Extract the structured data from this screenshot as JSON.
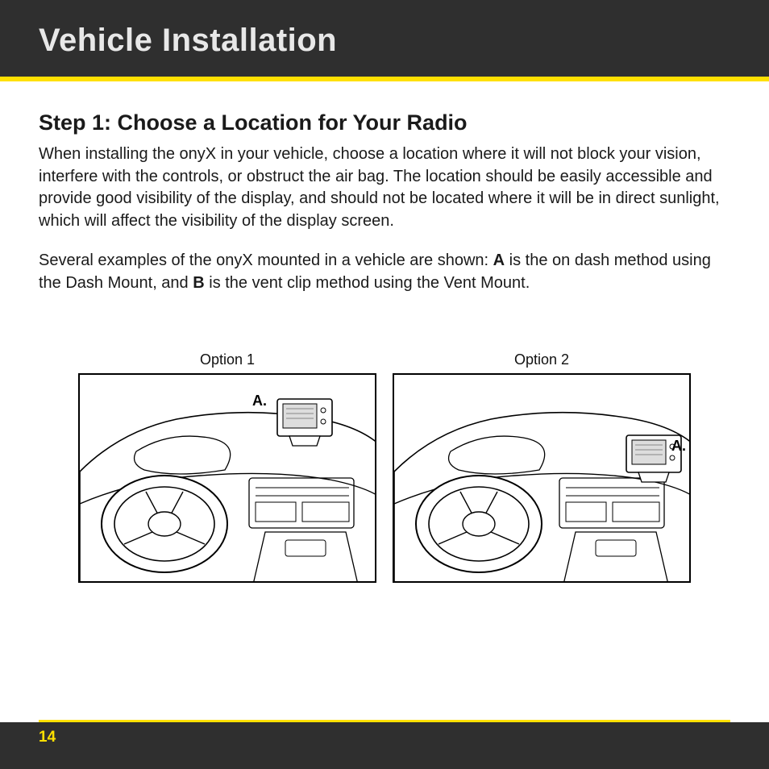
{
  "header": {
    "title": "Vehicle Installation"
  },
  "step": {
    "title": "Step 1: Choose a Location for Your Radio",
    "paragraph1": "When installing the onyX in your vehicle, choose a location where it will not block your vision, interfere with the controls, or obstruct the air bag. The location should be easily accessible and provide good visibility of the display, and should not be located where it will be in direct sunlight, which will affect the visibility of the display screen.",
    "paragraph2_pre": "Several examples of the onyX mounted in a vehicle are shown: ",
    "paragraph2_a": "A",
    "paragraph2_mid": " is the on dash method using the Dash Mount, and ",
    "paragraph2_b": "B",
    "paragraph2_post": " is the vent clip method using the Vent Mount."
  },
  "figures": {
    "option1": {
      "caption": "Option 1",
      "marker": "A."
    },
    "option2": {
      "caption": "Option 2",
      "marker": "A."
    }
  },
  "page_number": "14"
}
